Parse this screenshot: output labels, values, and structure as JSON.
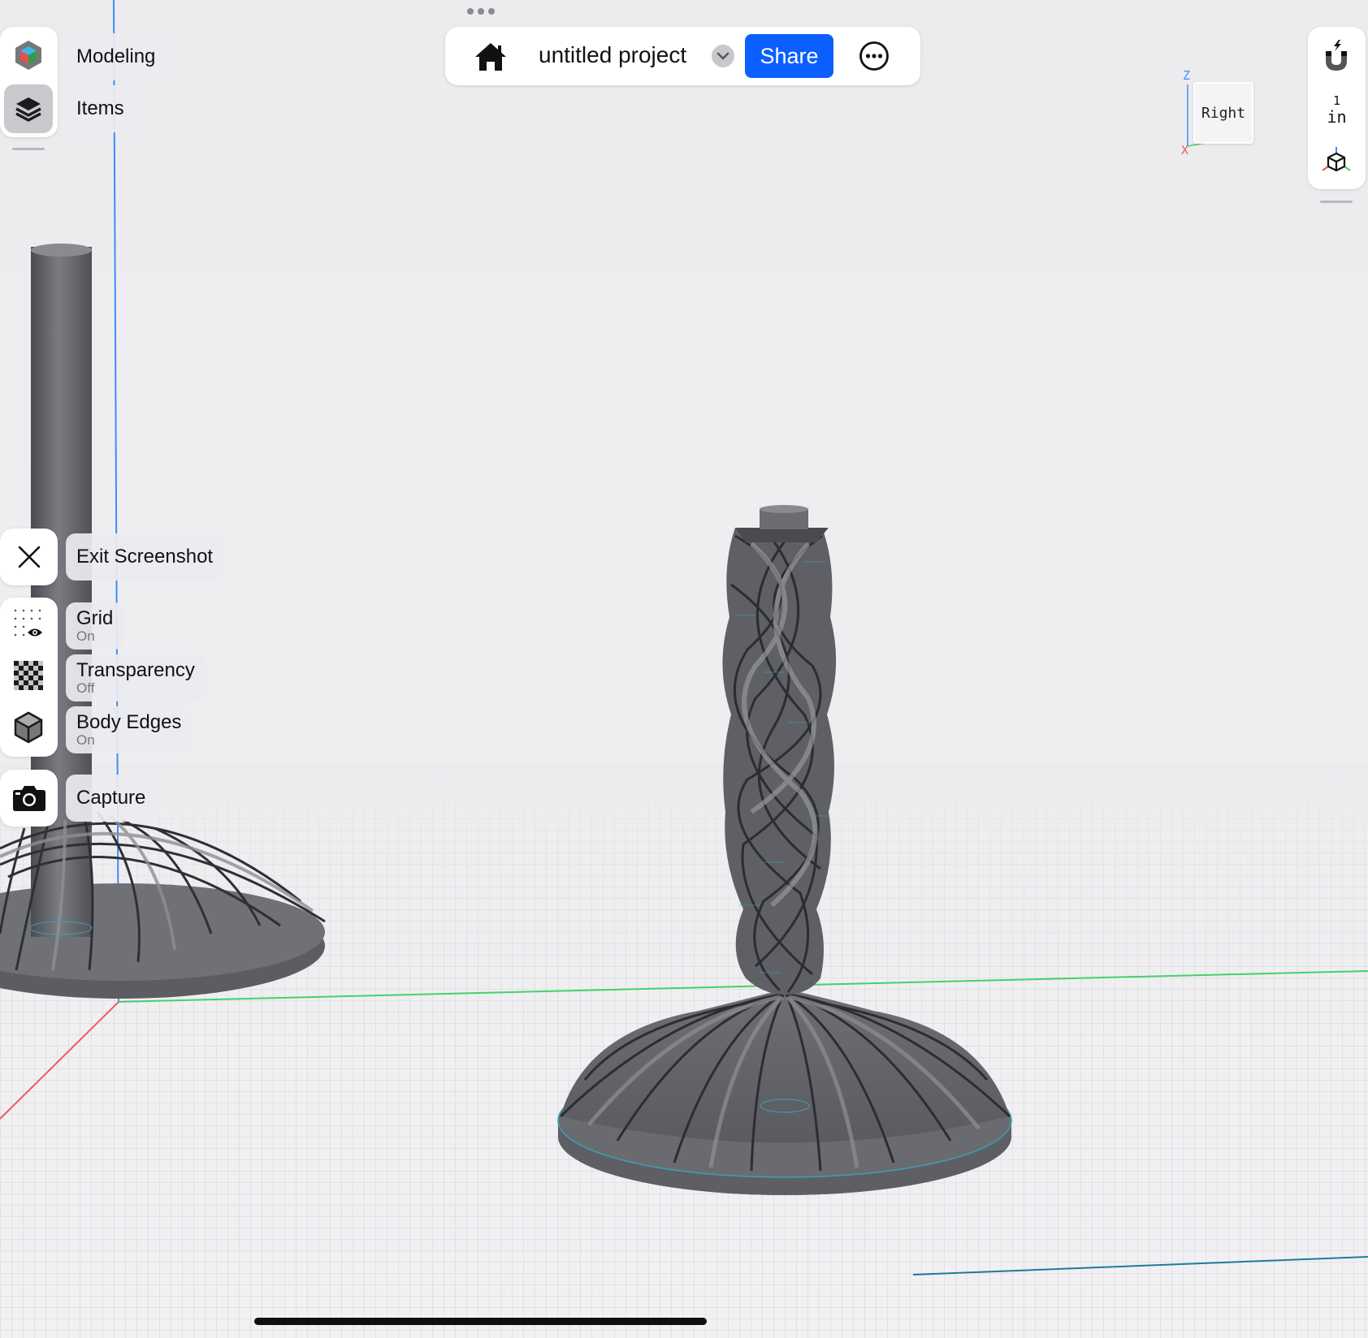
{
  "app": {
    "project_title": "untitled project",
    "share_label": "Share",
    "accent": "#0b5fff"
  },
  "left_menu": {
    "modeling_label": "Modeling",
    "items_label": "Items"
  },
  "screenshot_menu": {
    "exit_label": "Exit Screenshot",
    "grid_label": "Grid",
    "grid_state": "On",
    "transparency_label": "Transparency",
    "transparency_state": "Off",
    "body_edges_label": "Body Edges",
    "body_edges_state": "On",
    "capture_label": "Capture"
  },
  "view_cube": {
    "face_label": "Right",
    "z_label": "Z",
    "x_label": "X"
  },
  "right_toolbar": {
    "unit_value": "1",
    "unit_label": "in"
  },
  "icons": {
    "home": "home-icon",
    "dropdown": "chevron-down-icon",
    "more": "more-icon",
    "magnet": "magnet-icon",
    "view_cube": "view-cube-icon",
    "close": "close-icon",
    "grid": "grid-visibility-icon",
    "transparency": "checkerboard-icon",
    "body_edges": "cube-icon",
    "capture": "camera-icon"
  }
}
